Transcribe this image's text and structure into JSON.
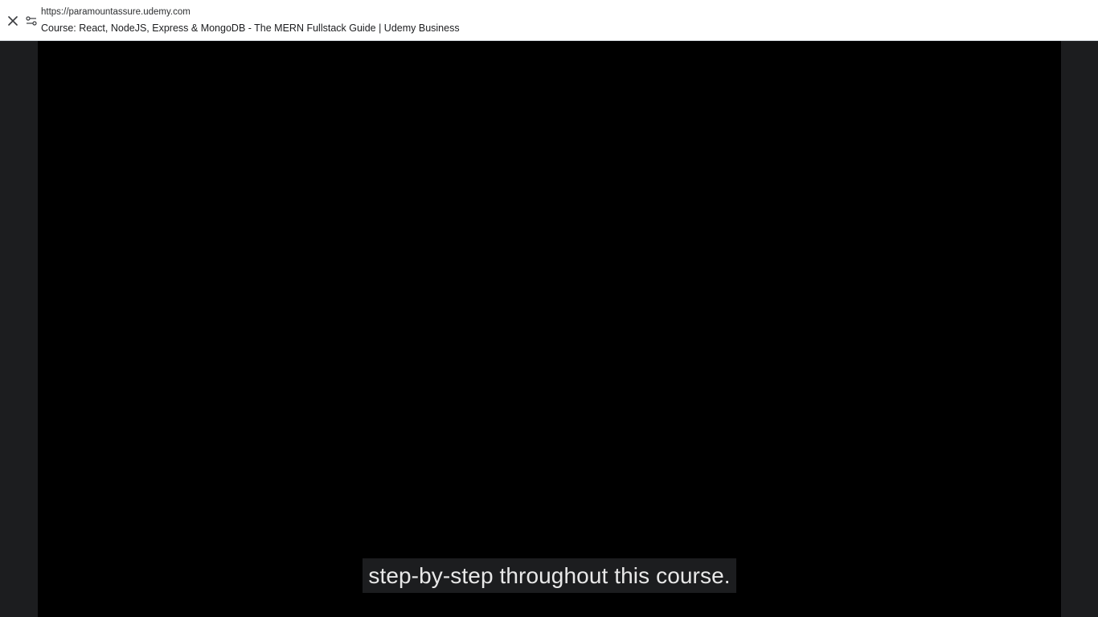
{
  "browser": {
    "url": "https://paramountassure.udemy.com",
    "title": "Course: React, NodeJS, Express & MongoDB - The MERN Fullstack Guide | Udemy Business",
    "close_icon": "close-icon",
    "site_info_icon": "tune-icon"
  },
  "player": {
    "caption": "step-by-step throughout this course."
  },
  "colors": {
    "topbar_bg": "#ffffff",
    "page_bg": "#1c1d1f",
    "video_bg": "#000000",
    "caption_bg": "#1c1d1f",
    "caption_text": "#e8e8e8"
  }
}
